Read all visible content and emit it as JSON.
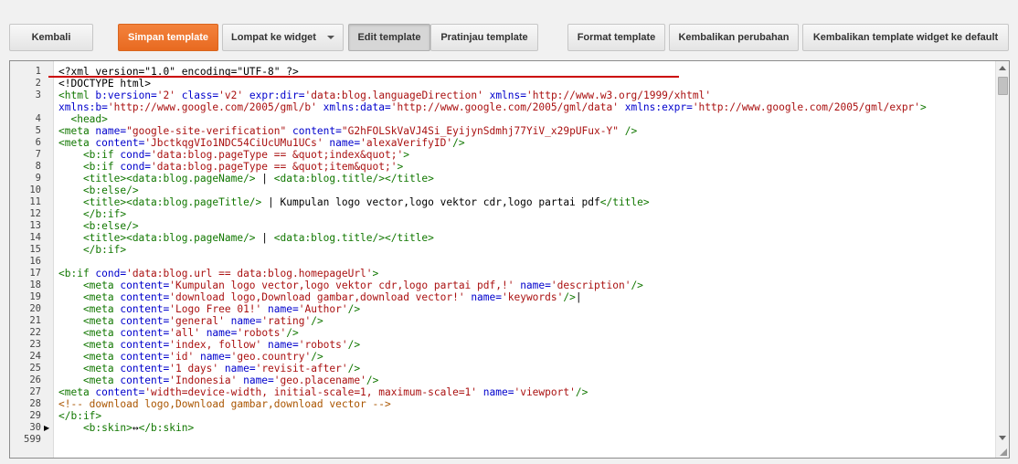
{
  "toolbar": {
    "back": "Kembali",
    "save": "Simpan template",
    "jump": "Lompat ke widget",
    "edit": "Edit template",
    "preview": "Pratinjau template",
    "format": "Format template",
    "revert": "Kembalikan perubahan",
    "revert_widgets": "Kembalikan template widget ke default"
  },
  "editor": {
    "lines": [
      {
        "n": "1",
        "segs": [
          [
            "plain",
            "<?xml version=\"1.0\" encoding=\"UTF-8\" ?>"
          ]
        ]
      },
      {
        "n": "2",
        "segs": [
          [
            "plain",
            "<!DOCTYPE html>"
          ]
        ]
      },
      {
        "n": "3",
        "segs": [
          [
            "tag",
            "<html "
          ],
          [
            "attr",
            "b:version="
          ],
          [
            "str",
            "'2'"
          ],
          [
            "plain",
            " "
          ],
          [
            "attr",
            "class="
          ],
          [
            "str",
            "'v2'"
          ],
          [
            "plain",
            " "
          ],
          [
            "attr",
            "expr:dir="
          ],
          [
            "str",
            "'data:blog.languageDirection'"
          ],
          [
            "plain",
            " "
          ],
          [
            "attr",
            "xmlns="
          ],
          [
            "str",
            "'http://www.w3.org/1999/xhtml'"
          ]
        ]
      },
      {
        "n": "",
        "segs": [
          [
            "attr",
            "xmlns:b="
          ],
          [
            "str",
            "'http://www.google.com/2005/gml/b'"
          ],
          [
            "plain",
            " "
          ],
          [
            "attr",
            "xmlns:data="
          ],
          [
            "str",
            "'http://www.google.com/2005/gml/data'"
          ],
          [
            "plain",
            " "
          ],
          [
            "attr",
            "xmlns:expr="
          ],
          [
            "str",
            "'http://www.google.com/2005/gml/expr'"
          ],
          [
            "tag",
            ">"
          ]
        ]
      },
      {
        "n": "4",
        "segs": [
          [
            "tag",
            "  <head>"
          ]
        ]
      },
      {
        "n": "5",
        "segs": [
          [
            "tag",
            "<meta "
          ],
          [
            "attr",
            "name="
          ],
          [
            "str",
            "\"google-site-verification\""
          ],
          [
            "plain",
            " "
          ],
          [
            "attr",
            "content="
          ],
          [
            "str",
            "\"G2hFOLSkVaVJ4Si_EyijynSdmhj77YiV_x29pUFux-Y\""
          ],
          [
            "plain",
            " "
          ],
          [
            "tag",
            "/>"
          ]
        ]
      },
      {
        "n": "6",
        "segs": [
          [
            "tag",
            "<meta "
          ],
          [
            "attr",
            "content="
          ],
          [
            "str",
            "'JbctkqgVIo1NDC54CiUcUMu1UCs'"
          ],
          [
            "plain",
            " "
          ],
          [
            "attr",
            "name="
          ],
          [
            "str",
            "'alexaVerifyID'"
          ],
          [
            "tag",
            "/>"
          ]
        ]
      },
      {
        "n": "7",
        "segs": [
          [
            "tag",
            "    <b:if "
          ],
          [
            "attr",
            "cond="
          ],
          [
            "str",
            "'data:blog.pageType == &quot;index&quot;'"
          ],
          [
            "tag",
            ">"
          ]
        ]
      },
      {
        "n": "8",
        "segs": [
          [
            "tag",
            "    <b:if "
          ],
          [
            "attr",
            "cond="
          ],
          [
            "str",
            "'data:blog.pageType == &quot;item&quot;'"
          ],
          [
            "tag",
            ">"
          ]
        ]
      },
      {
        "n": "9",
        "segs": [
          [
            "tag",
            "    <title><data:blog.pageName/>"
          ],
          [
            "plain",
            " | "
          ],
          [
            "tag",
            "<data:blog.title/></title>"
          ]
        ]
      },
      {
        "n": "10",
        "segs": [
          [
            "tag",
            "    <b:else/>"
          ]
        ]
      },
      {
        "n": "11",
        "segs": [
          [
            "tag",
            "    <title><data:blog.pageTitle/>"
          ],
          [
            "plain",
            " | Kumpulan logo vector,logo vektor cdr,logo partai pdf"
          ],
          [
            "tag",
            "</title>"
          ]
        ]
      },
      {
        "n": "12",
        "segs": [
          [
            "tag",
            "    </b:if>"
          ]
        ]
      },
      {
        "n": "13",
        "segs": [
          [
            "tag",
            "    <b:else/>"
          ]
        ]
      },
      {
        "n": "14",
        "segs": [
          [
            "tag",
            "    <title><data:blog.pageName/>"
          ],
          [
            "plain",
            " | "
          ],
          [
            "tag",
            "<data:blog.title/></title>"
          ]
        ]
      },
      {
        "n": "15",
        "segs": [
          [
            "tag",
            "    </b:if>"
          ]
        ]
      },
      {
        "n": "16",
        "segs": [
          [
            "plain",
            ""
          ]
        ]
      },
      {
        "n": "17",
        "segs": [
          [
            "tag",
            "<b:if "
          ],
          [
            "attr",
            "cond="
          ],
          [
            "str",
            "'data:blog.url == data:blog.homepageUrl'"
          ],
          [
            "tag",
            ">"
          ]
        ]
      },
      {
        "n": "18",
        "segs": [
          [
            "tag",
            "    <meta "
          ],
          [
            "attr",
            "content="
          ],
          [
            "str",
            "'Kumpulan logo vector,logo vektor cdr,logo partai pdf,!'"
          ],
          [
            "plain",
            " "
          ],
          [
            "attr",
            "name="
          ],
          [
            "str",
            "'description'"
          ],
          [
            "tag",
            "/>"
          ]
        ]
      },
      {
        "n": "19",
        "segs": [
          [
            "tag",
            "    <meta "
          ],
          [
            "attr",
            "content="
          ],
          [
            "str",
            "'download logo,Download gambar,download vector!'"
          ],
          [
            "plain",
            " "
          ],
          [
            "attr",
            "name="
          ],
          [
            "str",
            "'keywords'"
          ],
          [
            "tag",
            "/>"
          ],
          [
            "plain",
            "|"
          ]
        ]
      },
      {
        "n": "20",
        "segs": [
          [
            "tag",
            "    <meta "
          ],
          [
            "attr",
            "content="
          ],
          [
            "str",
            "'Logo Free 01!'"
          ],
          [
            "plain",
            " "
          ],
          [
            "attr",
            "name="
          ],
          [
            "str",
            "'Author'"
          ],
          [
            "tag",
            "/>"
          ]
        ]
      },
      {
        "n": "21",
        "segs": [
          [
            "tag",
            "    <meta "
          ],
          [
            "attr",
            "content="
          ],
          [
            "str",
            "'general'"
          ],
          [
            "plain",
            " "
          ],
          [
            "attr",
            "name="
          ],
          [
            "str",
            "'rating'"
          ],
          [
            "tag",
            "/>"
          ]
        ]
      },
      {
        "n": "22",
        "segs": [
          [
            "tag",
            "    <meta "
          ],
          [
            "attr",
            "content="
          ],
          [
            "str",
            "'all'"
          ],
          [
            "plain",
            " "
          ],
          [
            "attr",
            "name="
          ],
          [
            "str",
            "'robots'"
          ],
          [
            "tag",
            "/>"
          ]
        ]
      },
      {
        "n": "23",
        "segs": [
          [
            "tag",
            "    <meta "
          ],
          [
            "attr",
            "content="
          ],
          [
            "str",
            "'index, follow'"
          ],
          [
            "plain",
            " "
          ],
          [
            "attr",
            "name="
          ],
          [
            "str",
            "'robots'"
          ],
          [
            "tag",
            "/>"
          ]
        ]
      },
      {
        "n": "24",
        "segs": [
          [
            "tag",
            "    <meta "
          ],
          [
            "attr",
            "content="
          ],
          [
            "str",
            "'id'"
          ],
          [
            "plain",
            " "
          ],
          [
            "attr",
            "name="
          ],
          [
            "str",
            "'geo.country'"
          ],
          [
            "tag",
            "/>"
          ]
        ]
      },
      {
        "n": "25",
        "segs": [
          [
            "tag",
            "    <meta "
          ],
          [
            "attr",
            "content="
          ],
          [
            "str",
            "'1 days'"
          ],
          [
            "plain",
            " "
          ],
          [
            "attr",
            "name="
          ],
          [
            "str",
            "'revisit-after'"
          ],
          [
            "tag",
            "/>"
          ]
        ]
      },
      {
        "n": "26",
        "segs": [
          [
            "tag",
            "    <meta "
          ],
          [
            "attr",
            "content="
          ],
          [
            "str",
            "'Indonesia'"
          ],
          [
            "plain",
            " "
          ],
          [
            "attr",
            "name="
          ],
          [
            "str",
            "'geo.placename'"
          ],
          [
            "tag",
            "/>"
          ]
        ]
      },
      {
        "n": "27",
        "segs": [
          [
            "tag",
            "<meta "
          ],
          [
            "attr",
            "content="
          ],
          [
            "str",
            "'width=device-width, initial-scale=1, maximum-scale=1'"
          ],
          [
            "plain",
            " "
          ],
          [
            "attr",
            "name="
          ],
          [
            "str",
            "'viewport'"
          ],
          [
            "tag",
            "/>"
          ]
        ]
      },
      {
        "n": "28",
        "segs": [
          [
            "cmt",
            "<!-- download logo,Download gambar,download vector -->"
          ]
        ]
      },
      {
        "n": "29",
        "segs": [
          [
            "tag",
            "</b:if>"
          ]
        ]
      },
      {
        "n": "30",
        "fold": "▶",
        "segs": [
          [
            "tag",
            "    <b:skin>"
          ],
          [
            "plain",
            "↔"
          ],
          [
            "tag",
            "</b:skin>"
          ]
        ]
      },
      {
        "n": "599",
        "segs": [
          [
            "plain",
            ""
          ]
        ]
      }
    ]
  }
}
